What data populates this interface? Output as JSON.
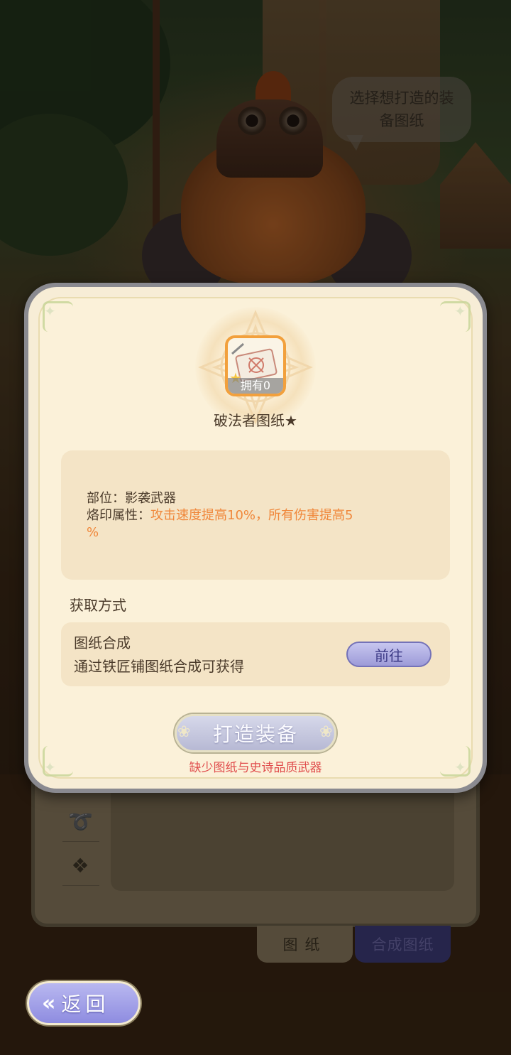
{
  "npc": {
    "speech": "选择想打造的装备图纸"
  },
  "item": {
    "owned_label": "拥有0",
    "name": "破法者图纸★"
  },
  "attributes": {
    "slot_label": "部位：",
    "slot_value": "影袭武器",
    "imprint_label": "烙印属性：",
    "imprint_value_line1": "攻击速度提高10%，所有伤害提高5",
    "imprint_value_line2": "%"
  },
  "acquire": {
    "title": "获取方式",
    "method_name": "图纸合成",
    "method_desc": "通过铁匠铺图纸合成可获得",
    "goto_label": "前往"
  },
  "actions": {
    "craft_label": "打造装备",
    "craft_hint": "缺少图纸与史诗品质武器"
  },
  "bottom_tabs": {
    "blueprint": "图纸",
    "synthesize": "合成图纸"
  },
  "back_button": {
    "label": "返回"
  },
  "colors": {
    "attr_value": "#f0873a",
    "hint_red": "#e04c4c",
    "button_purple": "#9d9bd8",
    "item_border": "#f2a03c"
  }
}
